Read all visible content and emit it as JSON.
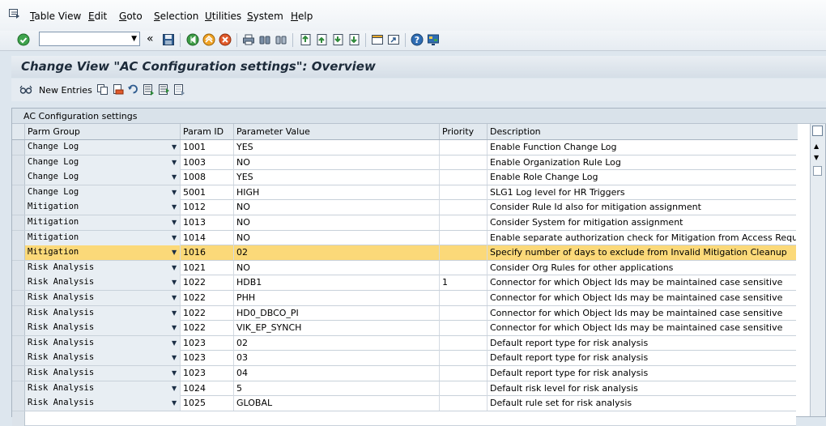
{
  "menu": {
    "items": [
      "Table View",
      "Edit",
      "Goto",
      "Selection",
      "Utilities",
      "System",
      "Help"
    ],
    "underline_first": [
      true,
      true,
      true,
      true,
      true,
      true,
      true
    ]
  },
  "toolbar": {
    "command_field": "",
    "icons": [
      "enter-check-icon",
      "command-field-dropdown",
      "collapse-icon",
      "save-icon",
      "back-icon",
      "exit-icon",
      "cancel-icon",
      "print-icon",
      "find-icon",
      "find-next-icon",
      "first-page-icon",
      "previous-page-icon",
      "next-page-icon",
      "last-page-icon",
      "create-session-icon",
      "shortcut-icon",
      "help-icon",
      "customize-layout-icon"
    ]
  },
  "page": {
    "title": "Change View \"AC Configuration settings\": Overview",
    "new_entries": "New Entries"
  },
  "table": {
    "title": "AC Configuration settings",
    "headers": [
      "Parm Group",
      "Param ID",
      "Parameter Value",
      "Priority",
      "Description"
    ],
    "rows": [
      {
        "group": "Change Log",
        "id": "1001",
        "value": "YES",
        "priority": "",
        "desc": "Enable Function Change Log"
      },
      {
        "group": "Change Log",
        "id": "1003",
        "value": "NO",
        "priority": "",
        "desc": "Enable Organization Rule Log"
      },
      {
        "group": "Change Log",
        "id": "1008",
        "value": "YES",
        "priority": "",
        "desc": "Enable Role Change Log"
      },
      {
        "group": "Change Log",
        "id": "5001",
        "value": "HIGH",
        "priority": "",
        "desc": "SLG1 Log level for HR Triggers"
      },
      {
        "group": "Mitigation",
        "id": "1012",
        "value": "NO",
        "priority": "",
        "desc": "Consider Rule Id also for mitigation assignment"
      },
      {
        "group": "Mitigation",
        "id": "1013",
        "value": "NO",
        "priority": "",
        "desc": "Consider System for mitigation assignment"
      },
      {
        "group": "Mitigation",
        "id": "1014",
        "value": "NO",
        "priority": "",
        "desc": "Enable separate authorization check for Mitigation from Access Request"
      },
      {
        "group": "Mitigation",
        "id": "1016",
        "value": "02",
        "priority": "",
        "desc": "Specify number of days to exclude from Invalid Mitigation Cleanup",
        "selected": true
      },
      {
        "group": "Risk Analysis",
        "id": "1021",
        "value": "NO",
        "priority": "",
        "desc": "Consider Org Rules for other applications"
      },
      {
        "group": "Risk Analysis",
        "id": "1022",
        "value": "HDB1",
        "priority": "1",
        "desc": "Connector for which Object Ids may be maintained case sensitive"
      },
      {
        "group": "Risk Analysis",
        "id": "1022",
        "value": "PHH",
        "priority": "",
        "desc": "Connector for which Object Ids may be maintained case sensitive"
      },
      {
        "group": "Risk Analysis",
        "id": "1022",
        "value": "HD0_DBCO_PI",
        "priority": "",
        "desc": "Connector for which Object Ids may be maintained case sensitive"
      },
      {
        "group": "Risk Analysis",
        "id": "1022",
        "value": "VIK_EP_SYNCH",
        "priority": "",
        "desc": "Connector for which Object Ids may be maintained case sensitive"
      },
      {
        "group": "Risk Analysis",
        "id": "1023",
        "value": "02",
        "priority": "",
        "desc": "Default report type for risk analysis"
      },
      {
        "group": "Risk Analysis",
        "id": "1023",
        "value": "03",
        "priority": "",
        "desc": "Default report type for risk analysis"
      },
      {
        "group": "Risk Analysis",
        "id": "1023",
        "value": "04",
        "priority": "",
        "desc": "Default report type for risk analysis"
      },
      {
        "group": "Risk Analysis",
        "id": "1024",
        "value": "5",
        "priority": "",
        "desc": "Default risk level for risk analysis"
      },
      {
        "group": "Risk Analysis",
        "id": "1025",
        "value": "GLOBAL",
        "priority": "",
        "desc": "Default rule set for risk analysis"
      }
    ]
  },
  "colors": {
    "selected_row": "#fbd979",
    "title_text": "#1d2b3a"
  }
}
